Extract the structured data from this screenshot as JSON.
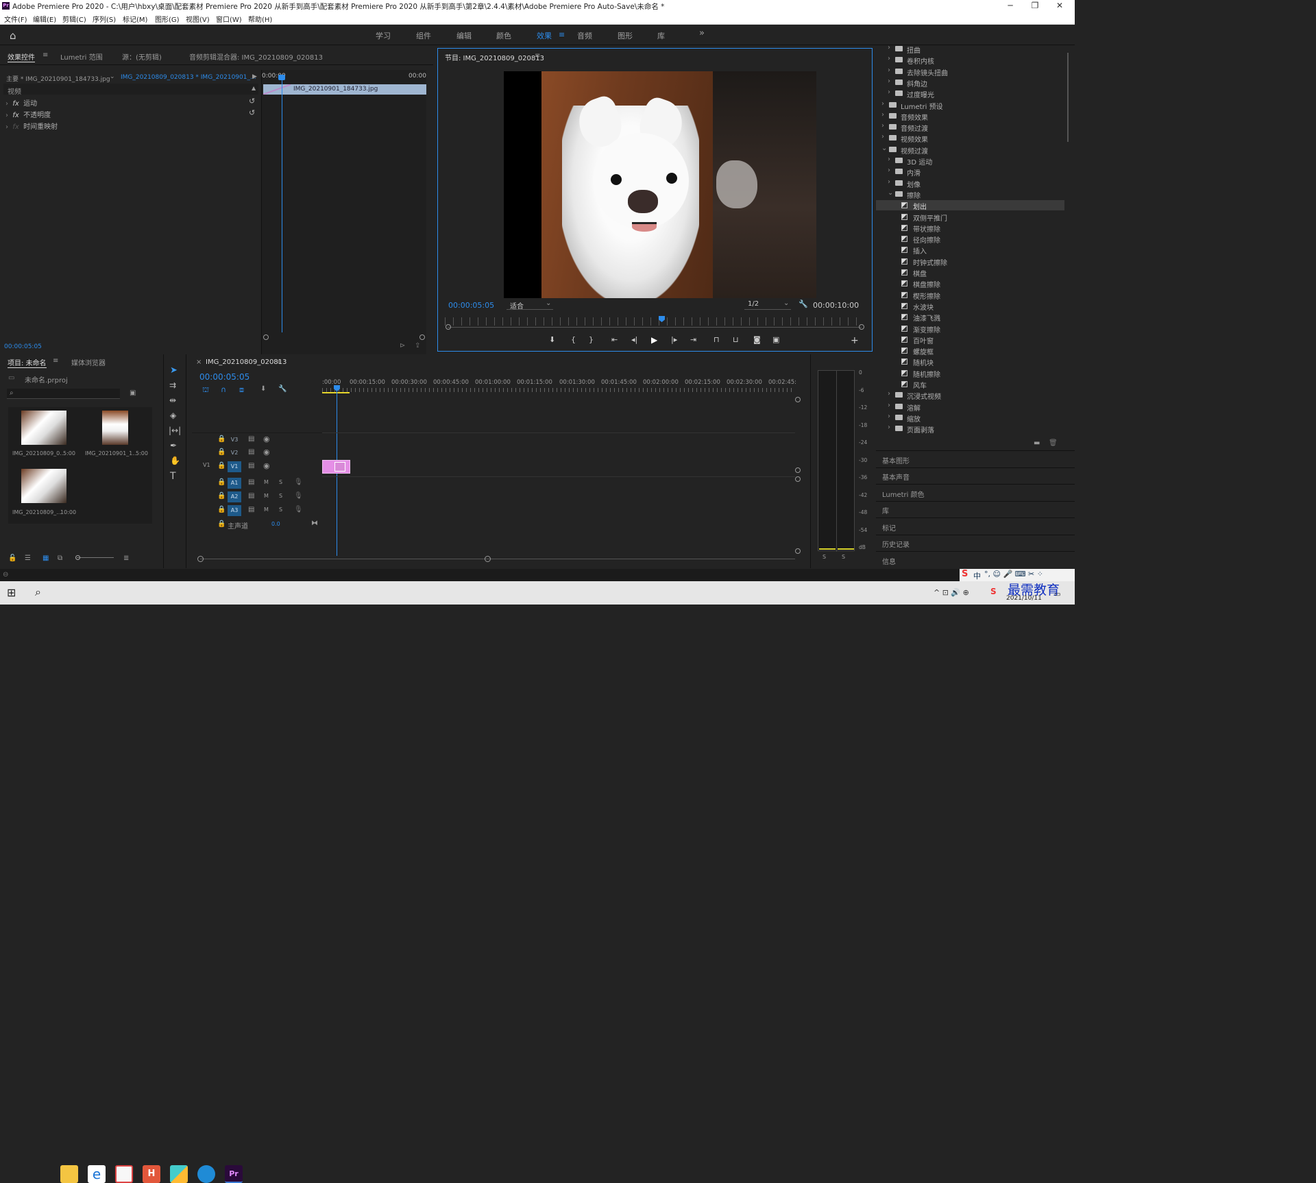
{
  "window": {
    "title": "Adobe Premiere Pro 2020 - C:\\用户\\hbxy\\桌面\\配套素材 Premiere Pro 2020 从新手到高手\\配套素材 Premiere Pro 2020 从新手到高手\\第2章\\2.4.4\\素材\\Adobe Premiere Pro Auto-Save\\未命名 *",
    "logo": "Pr"
  },
  "menu": [
    "文件(F)",
    "编辑(E)",
    "剪辑(C)",
    "序列(S)",
    "标记(M)",
    "图形(G)",
    "视图(V)",
    "窗口(W)",
    "帮助(H)"
  ],
  "workspaces": [
    "学习",
    "组件",
    "编辑",
    "颜色",
    "效果",
    "音频",
    "图形",
    "库"
  ],
  "active_workspace": "效果",
  "effect_controls": {
    "tabs": [
      "效果控件",
      "Lumetri 范围",
      "源：(无剪辑)",
      "音频剪辑混合器: IMG_20210809_020813"
    ],
    "master": "主要 * IMG_20210901_184733.jpg",
    "sequence": "IMG_20210809_020813 * IMG_20210901_...",
    "time_start": "0:00:00",
    "time_end": "00:00",
    "clip": "IMG_20210901_184733.jpg",
    "section": "视频",
    "effects": [
      "运动",
      "不透明度",
      "时间重映射"
    ],
    "timecode": "00:00:05:05"
  },
  "program": {
    "title": "节目: IMG_20210809_020813",
    "timecode": "00:00:05:05",
    "fit": "适合",
    "quality": "1/2",
    "duration": "00:00:10:00",
    "playhead_fraction": 0.5
  },
  "project": {
    "tabs": [
      "项目: 未命名",
      "媒体浏览器"
    ],
    "file": "未命名.prproj",
    "items": [
      {
        "name": "IMG_20210809_0...",
        "dur": "5:00"
      },
      {
        "name": "IMG_20210901_1...",
        "dur": "5:00"
      },
      {
        "name": "IMG_20210809_...",
        "dur": "10:00"
      }
    ]
  },
  "timeline": {
    "title": "IMG_20210809_020813",
    "timecode": "00:00:05:05",
    "ruler": [
      ":00:00",
      "00:00:15:00",
      "00:00:30:00",
      "00:00:45:00",
      "00:01:00:00",
      "00:01:15:00",
      "00:01:30:00",
      "00:01:45:00",
      "00:02:00:00",
      "00:02:15:00",
      "00:02:30:00",
      "00:02:45:"
    ],
    "video_tracks": [
      "V3",
      "V2",
      "V1"
    ],
    "audio_tracks": [
      "A1",
      "A2",
      "A3"
    ],
    "source_label": "V1",
    "master": "主声道",
    "master_value": "0.0",
    "m": "M",
    "s": "S"
  },
  "meter": {
    "ticks": [
      "0",
      "-6",
      "-12",
      "-18",
      "-24",
      "-30",
      "-36",
      "-42",
      "-48",
      "-54",
      "dB"
    ],
    "solo": [
      "S",
      "S"
    ]
  },
  "effects_tree": [
    {
      "label": "扭曲",
      "level": 1,
      "kind": "folder"
    },
    {
      "label": "卷积内核",
      "level": 1,
      "kind": "folder"
    },
    {
      "label": "去除镜头扭曲",
      "level": 1,
      "kind": "folder"
    },
    {
      "label": "斜角边",
      "level": 1,
      "kind": "folder"
    },
    {
      "label": "过度曝光",
      "level": 1,
      "kind": "folder"
    },
    {
      "label": "Lumetri 预设",
      "level": 0,
      "kind": "folder"
    },
    {
      "label": "音频效果",
      "level": 0,
      "kind": "folder"
    },
    {
      "label": "音频过渡",
      "level": 0,
      "kind": "folder"
    },
    {
      "label": "视频效果",
      "level": 0,
      "kind": "folder"
    },
    {
      "label": "视频过渡",
      "level": 0,
      "kind": "folder-open"
    },
    {
      "label": "3D 运动",
      "level": 1,
      "kind": "folder"
    },
    {
      "label": "内滑",
      "level": 1,
      "kind": "folder"
    },
    {
      "label": "划像",
      "level": 1,
      "kind": "folder"
    },
    {
      "label": "擦除",
      "level": 1,
      "kind": "folder-open"
    },
    {
      "label": "划出",
      "level": 2,
      "kind": "fx",
      "selected": true
    },
    {
      "label": "双侧平推门",
      "level": 2,
      "kind": "fx"
    },
    {
      "label": "带状擦除",
      "level": 2,
      "kind": "fx"
    },
    {
      "label": "径向擦除",
      "level": 2,
      "kind": "fx"
    },
    {
      "label": "插入",
      "level": 2,
      "kind": "fx"
    },
    {
      "label": "时钟式擦除",
      "level": 2,
      "kind": "fx"
    },
    {
      "label": "棋盘",
      "level": 2,
      "kind": "fx"
    },
    {
      "label": "棋盘擦除",
      "level": 2,
      "kind": "fx"
    },
    {
      "label": "楔形擦除",
      "level": 2,
      "kind": "fx"
    },
    {
      "label": "水波块",
      "level": 2,
      "kind": "fx"
    },
    {
      "label": "油漆飞溅",
      "level": 2,
      "kind": "fx"
    },
    {
      "label": "渐变擦除",
      "level": 2,
      "kind": "fx"
    },
    {
      "label": "百叶窗",
      "level": 2,
      "kind": "fx"
    },
    {
      "label": "螺旋框",
      "level": 2,
      "kind": "fx"
    },
    {
      "label": "随机块",
      "level": 2,
      "kind": "fx"
    },
    {
      "label": "随机擦除",
      "level": 2,
      "kind": "fx"
    },
    {
      "label": "风车",
      "level": 2,
      "kind": "fx"
    },
    {
      "label": "沉浸式视频",
      "level": 1,
      "kind": "folder"
    },
    {
      "label": "溶解",
      "level": 1,
      "kind": "folder"
    },
    {
      "label": "缩放",
      "level": 1,
      "kind": "folder"
    },
    {
      "label": "页面剥落",
      "level": 1,
      "kind": "folder"
    }
  ],
  "side_panels": [
    "基本图形",
    "基本声音",
    "Lumetri 颜色",
    "库",
    "标记",
    "历史记录",
    "信息"
  ],
  "taskbar": {
    "date": "2021/10/11",
    "watermark": "最需教育",
    "ime": "中"
  }
}
